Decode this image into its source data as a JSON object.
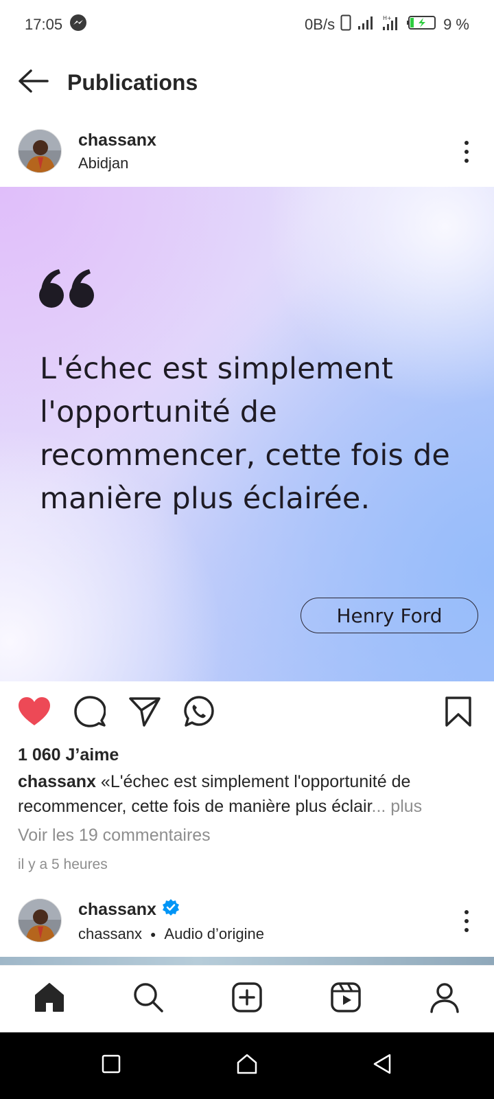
{
  "status_bar": {
    "time": "17:05",
    "net_speed": "0B/s",
    "battery": "9 %",
    "icons": [
      "messenger-icon",
      "sim-icon",
      "signal-icon",
      "signal-h-icon",
      "battery-charging-icon"
    ]
  },
  "header": {
    "title": "Publications",
    "back_icon": "arrow-left-icon"
  },
  "post": {
    "username": "chassanx",
    "location": "Abidjan",
    "quote": "L'échec est simplement l'opportunité de recommencer, cette fois de manière plus éclairée.",
    "author": "Henry Ford",
    "liked": true,
    "likes_text": "1 060 J’aime",
    "caption_user": "chassanx",
    "caption_text": "«L'échec est simplement l'opportunité de recommencer, cette fois de manière plus éclair",
    "caption_ellipsis": "...",
    "caption_more": " plus",
    "view_comments": "Voir les 19 commentaires",
    "timestamp": "il y a 5 heures",
    "actions": [
      "heart-filled-icon",
      "comment-icon",
      "share-icon",
      "whatsapp-icon",
      "bookmark-icon"
    ],
    "colors": {
      "like": "#ed4956",
      "text": "#262626",
      "muted": "#8e8e8e"
    }
  },
  "next_post": {
    "username": "chassanx",
    "verified": true,
    "sub_user": "chassanx",
    "audio": "Audio d’origine",
    "verified_color": "#0095f6"
  },
  "bottom_nav": [
    "home-icon",
    "search-icon",
    "create-icon",
    "reels-icon",
    "profile-icon"
  ],
  "system_nav": [
    "recent-apps-icon",
    "home-circle-icon",
    "back-triangle-icon"
  ]
}
